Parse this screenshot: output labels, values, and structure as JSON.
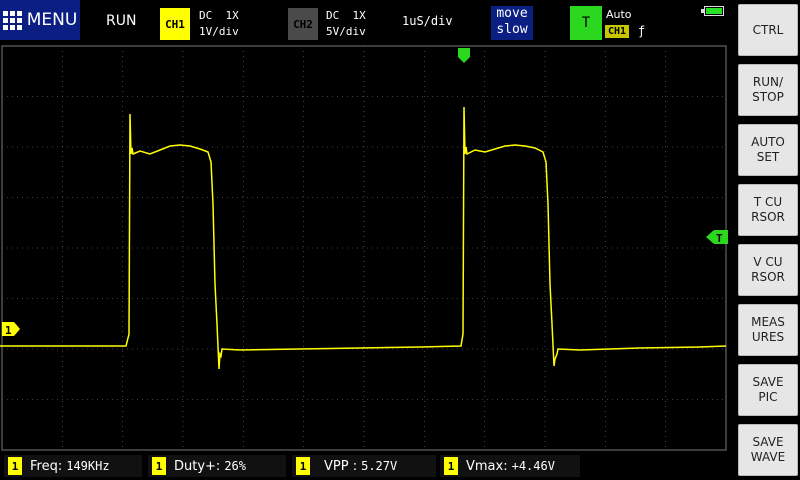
{
  "header": {
    "menu_label": "MENU",
    "run_status": "RUN",
    "ch1": {
      "badge": "CH1",
      "coupling": "DC  1X",
      "scale": "1V/div",
      "color": "#ffff00"
    },
    "ch2": {
      "badge": "CH2",
      "coupling": "DC  1X",
      "scale": "5V/div",
      "color": "#4a4a4a"
    },
    "timebase": "1uS/div",
    "move_line1": "move",
    "move_line2": "slow",
    "trigger": {
      "badge": "T",
      "mode": "Auto",
      "source": "CH1",
      "edge": "ƒ",
      "color": "#2bd81f"
    },
    "battery": {
      "level": 1.0
    }
  },
  "sidebar": {
    "buttons": [
      {
        "label": "CTRL"
      },
      {
        "label": "RUN/\nSTOP"
      },
      {
        "label": "AUTO\nSET"
      },
      {
        "label": "T CU\nRSOR"
      },
      {
        "label": "V CU\nRSOR"
      },
      {
        "label": "MEAS\nURES"
      },
      {
        "label": "SAVE\nPIC"
      },
      {
        "label": "SAVE\nWAVE"
      }
    ]
  },
  "scope": {
    "ch1_marker": "1",
    "trigger_marker": "T",
    "trace_color": "#ffff00"
  },
  "measurements": [
    {
      "tag": "1",
      "label": "Freq:",
      "value": "149KHz"
    },
    {
      "tag": "1",
      "label": "Duty+:",
      "value": "26%"
    },
    {
      "tag": "1",
      "label": "VPP :",
      "value": "5.27V"
    },
    {
      "tag": "1",
      "label": "Vmax:",
      "value": "+4.46V"
    }
  ]
}
